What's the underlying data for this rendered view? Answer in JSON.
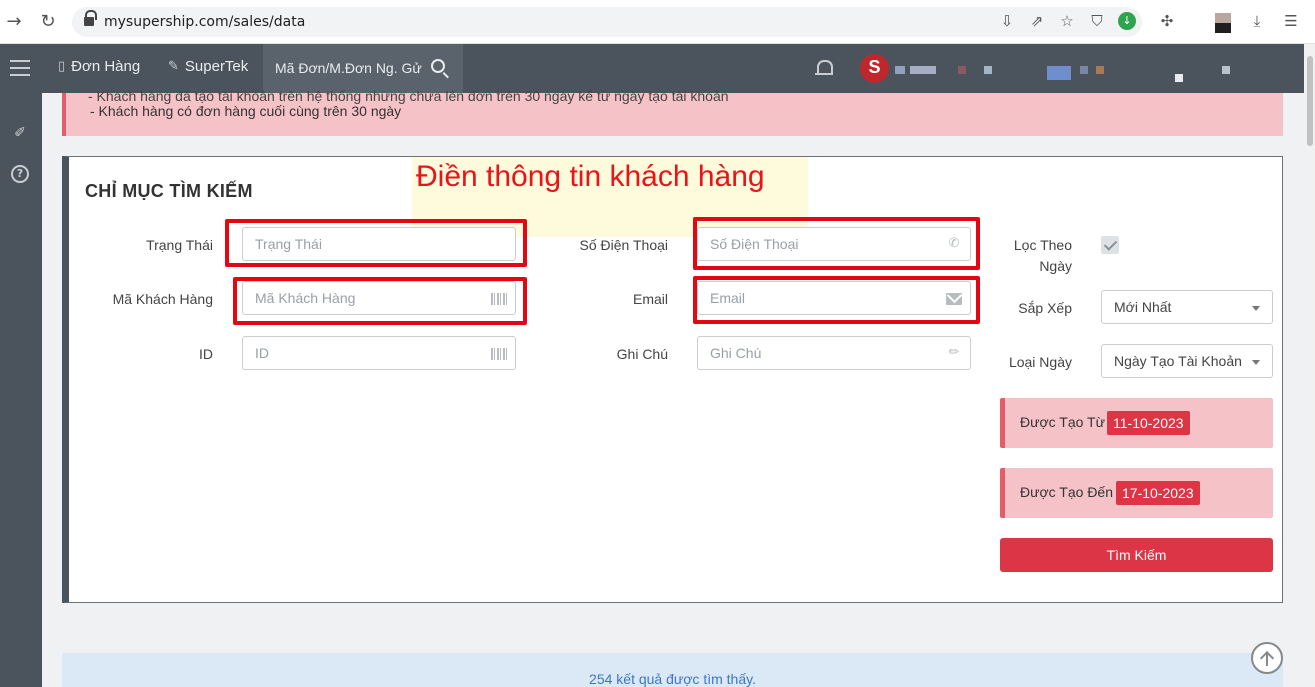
{
  "browser": {
    "url": "mysupership.com/sales/data"
  },
  "nav": {
    "orders_label": "Đơn Hàng",
    "supertek_label": "SuperTek",
    "search_placeholder": "Mã Đơn/M.Đơn Ng. Gử",
    "avatar_letter": "S"
  },
  "alert": {
    "line1": "- Khách hàng đã tạo tài khoản trên hệ thống nhưng chưa lên đơn trên 30 ngày kể từ ngày tạo tài khoản",
    "line2": "- Khách hàng có đơn hàng cuối cùng trên 30 ngày"
  },
  "panel": {
    "title": "CHỈ MỤC TÌM KIẾM",
    "annotation": "Điền thông tin khách hàng",
    "fields": {
      "status": {
        "label": "Trạng Thái",
        "placeholder": "Trạng Thái"
      },
      "customer_code": {
        "label": "Mã Khách Hàng",
        "placeholder": "Mã Khách Hàng"
      },
      "id": {
        "label": "ID",
        "placeholder": "ID"
      },
      "phone": {
        "label": "Số Điện Thoại",
        "placeholder": "Số Điện Thoại"
      },
      "email": {
        "label": "Email",
        "placeholder": "Email"
      },
      "note": {
        "label": "Ghi Chú",
        "placeholder": "Ghi Chú"
      }
    },
    "filter_by_date": {
      "label_line1": "Lọc Theo",
      "label_line2": "Ngày",
      "checked": true
    },
    "sort": {
      "label": "Sắp Xếp",
      "value": "Mới Nhất"
    },
    "date_type": {
      "label": "Loại Ngày",
      "value": "Ngày Tạo Tài Khoản"
    },
    "created_from": {
      "label": "Được Tạo Từ",
      "value": "11-10-2023"
    },
    "created_to": {
      "label": "Được Tạo Đến",
      "value": "17-10-2023"
    },
    "search_button": "Tìm Kiếm"
  },
  "results": {
    "text": "254 kết quả được tìm thấy."
  },
  "colors": {
    "nav_bg": "#4b545c",
    "alert_bg": "#f5c2c7",
    "danger": "#dc3545",
    "annotation_red": "#e30613",
    "info_bg": "#dbe8f6",
    "info_text": "#3a78c3"
  }
}
